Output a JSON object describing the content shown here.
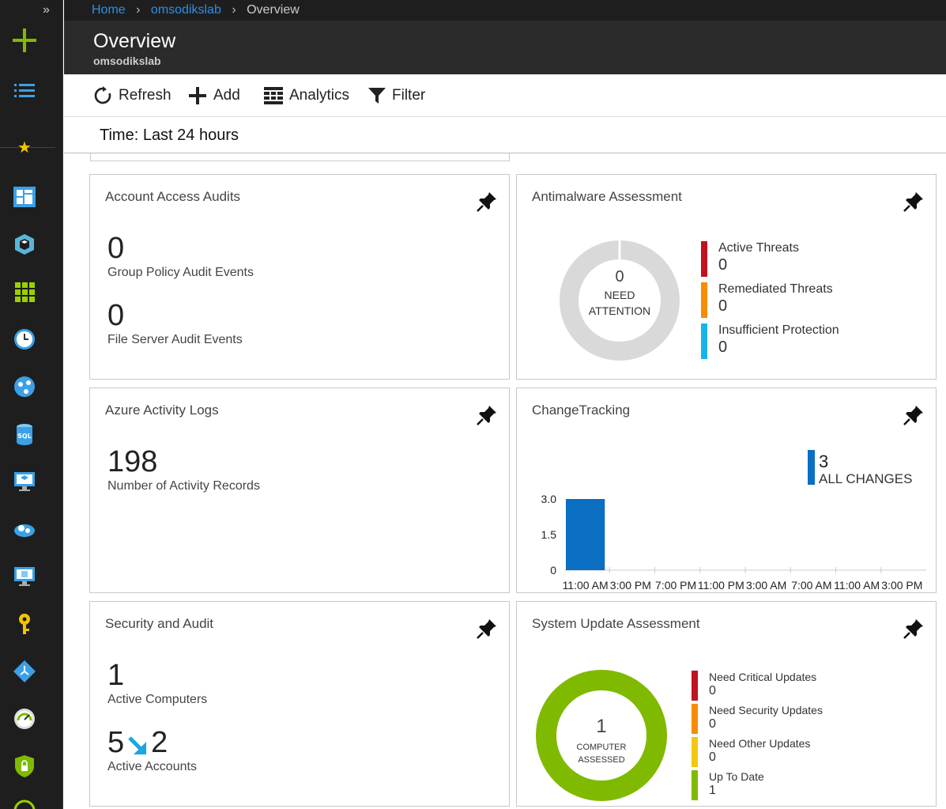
{
  "breadcrumb": {
    "home": "Home",
    "workspace": "omsodikslab",
    "current": "Overview"
  },
  "header": {
    "title": "Overview",
    "subtitle": "omsodikslab"
  },
  "toolbar": {
    "refresh": "Refresh",
    "add": "Add",
    "analytics": "Analytics",
    "filter": "Filter"
  },
  "time": {
    "label": "Time: Last 24 hours"
  },
  "tiles": {
    "account_access": {
      "title": "Account Access Audits",
      "group_policy_value": "0",
      "group_policy_label": "Group Policy Audit Events",
      "file_server_value": "0",
      "file_server_label": "File Server Audit Events"
    },
    "antimalware": {
      "title": "Antimalware Assessment",
      "center_value": "0",
      "center_label_1": "NEED",
      "center_label_2": "ATTENTION",
      "legend": [
        {
          "label": "Active Threats",
          "value": "0",
          "color": "#c1121f"
        },
        {
          "label": "Remediated Threats",
          "value": "0",
          "color": "#f78c00"
        },
        {
          "label": "Insufficient Protection",
          "value": "0",
          "color": "#17b4ea"
        }
      ]
    },
    "azure_activity": {
      "title": "Azure Activity Logs",
      "value": "198",
      "label": "Number of Activity Records"
    },
    "change_tracking": {
      "title": "ChangeTracking",
      "total_value": "3",
      "total_label": "ALL CHANGES"
    },
    "security_audit": {
      "title": "Security and Audit",
      "computers_value": "1",
      "computers_label": "Active Computers",
      "accounts_from": "5",
      "accounts_to": "2",
      "accounts_label": "Active Accounts"
    },
    "system_update": {
      "title": "System Update Assessment",
      "center_value": "1",
      "center_label_1": "COMPUTER",
      "center_label_2": "ASSESSED",
      "legend": [
        {
          "label": "Need Critical Updates",
          "value": "0",
          "color": "#c1121f"
        },
        {
          "label": "Need Security Updates",
          "value": "0",
          "color": "#f78c00"
        },
        {
          "label": "Need Other Updates",
          "value": "0",
          "color": "#f2c811"
        },
        {
          "label": "Up To Date",
          "value": "1",
          "color": "#7fba00"
        }
      ]
    }
  },
  "chart_data": {
    "type": "bar",
    "categories": [
      "11:00 AM",
      "3:00 PM",
      "7:00 PM",
      "11:00 PM",
      "3:00 AM",
      "7:00 AM",
      "11:00 AM",
      "3:00 PM"
    ],
    "values": [
      3,
      0,
      0,
      0,
      0,
      0,
      0,
      0
    ],
    "yticks": [
      "3.0",
      "1.5",
      "0"
    ],
    "ylim": [
      0,
      3
    ],
    "color": "#0a6fc2",
    "grid": false
  }
}
